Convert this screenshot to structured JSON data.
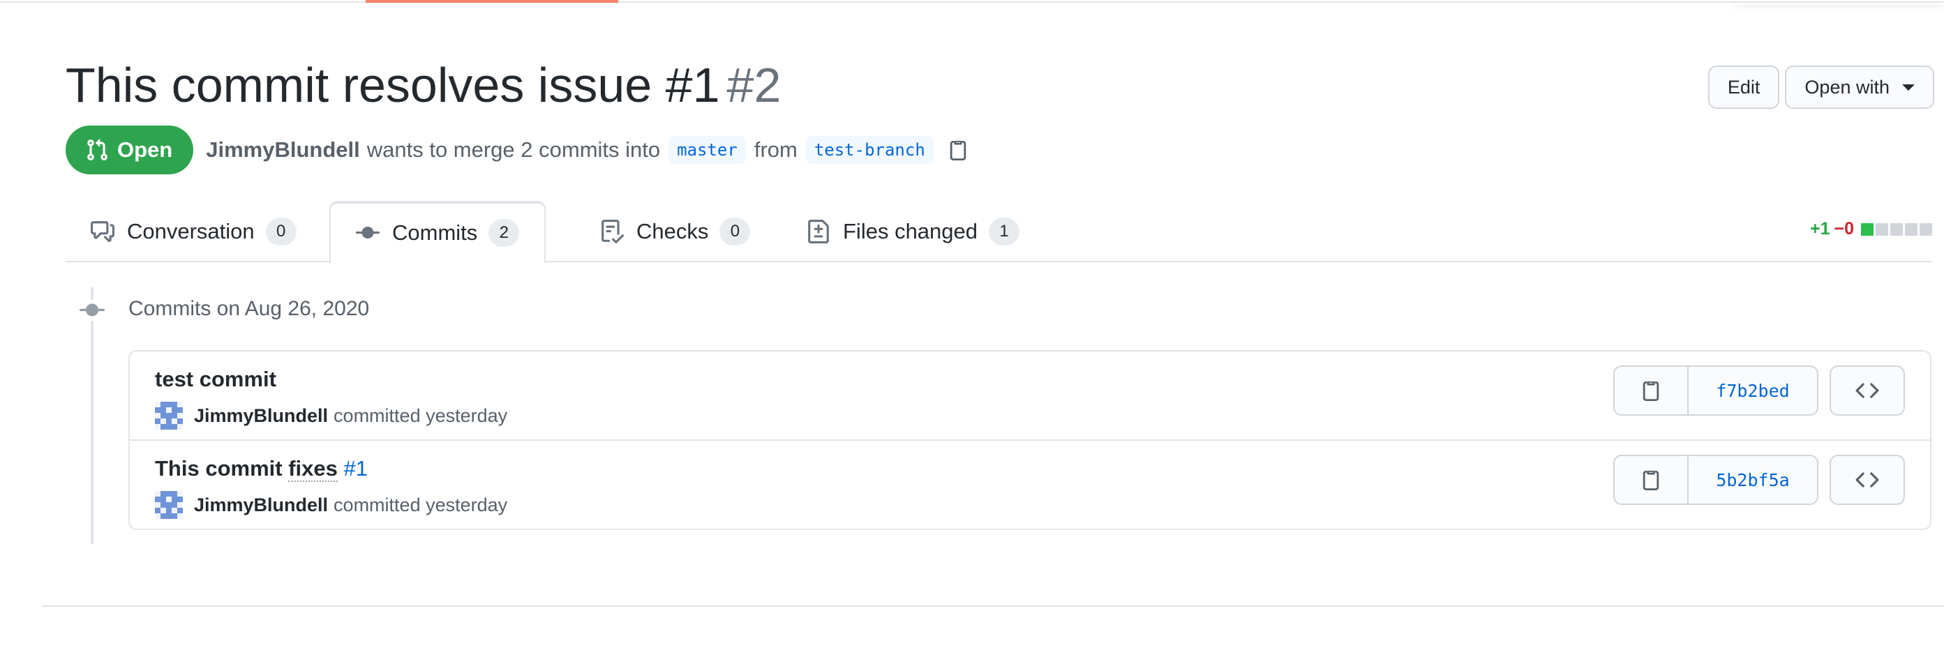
{
  "pr": {
    "title": "This commit resolves issue #1",
    "number": "#2",
    "state": "Open",
    "author": "JimmyBlundell",
    "merge_text": "wants to merge 2 commits into",
    "base_branch": "master",
    "from_text": "from",
    "head_branch": "test-branch"
  },
  "actions": {
    "edit_label": "Edit",
    "open_with_label": "Open with"
  },
  "tabs": [
    {
      "label": "Conversation",
      "count": "0",
      "icon": "comment-discussion-icon"
    },
    {
      "label": "Commits",
      "count": "2",
      "icon": "git-commit-icon",
      "selected": true
    },
    {
      "label": "Checks",
      "count": "0",
      "icon": "checklist-icon"
    },
    {
      "label": "Files changed",
      "count": "1",
      "icon": "file-diff-icon"
    }
  ],
  "diffstat": {
    "additions": "+1",
    "deletions": "−0",
    "blocks": [
      "added",
      "neutral",
      "neutral",
      "neutral",
      "neutral"
    ],
    "colors": {
      "added": "#2cbe4e",
      "neutral": "#d1d5da"
    }
  },
  "commits_section": {
    "date_label": "Commits on Aug 26, 2020",
    "commits": [
      {
        "title": "test commit",
        "author": "JimmyBlundell",
        "time_text": "committed yesterday",
        "sha": "f7b2bed"
      },
      {
        "title_prefix": "This commit",
        "title_keyword": "fixes",
        "issue_ref": "#1",
        "author": "JimmyBlundell",
        "time_text": "committed yesterday",
        "sha": "5b2bf5a"
      }
    ]
  },
  "colors": {
    "open_green": "#2ea44f",
    "link_blue": "#0366d6",
    "border": "#e1e4e8",
    "progress": "#f9826c"
  }
}
